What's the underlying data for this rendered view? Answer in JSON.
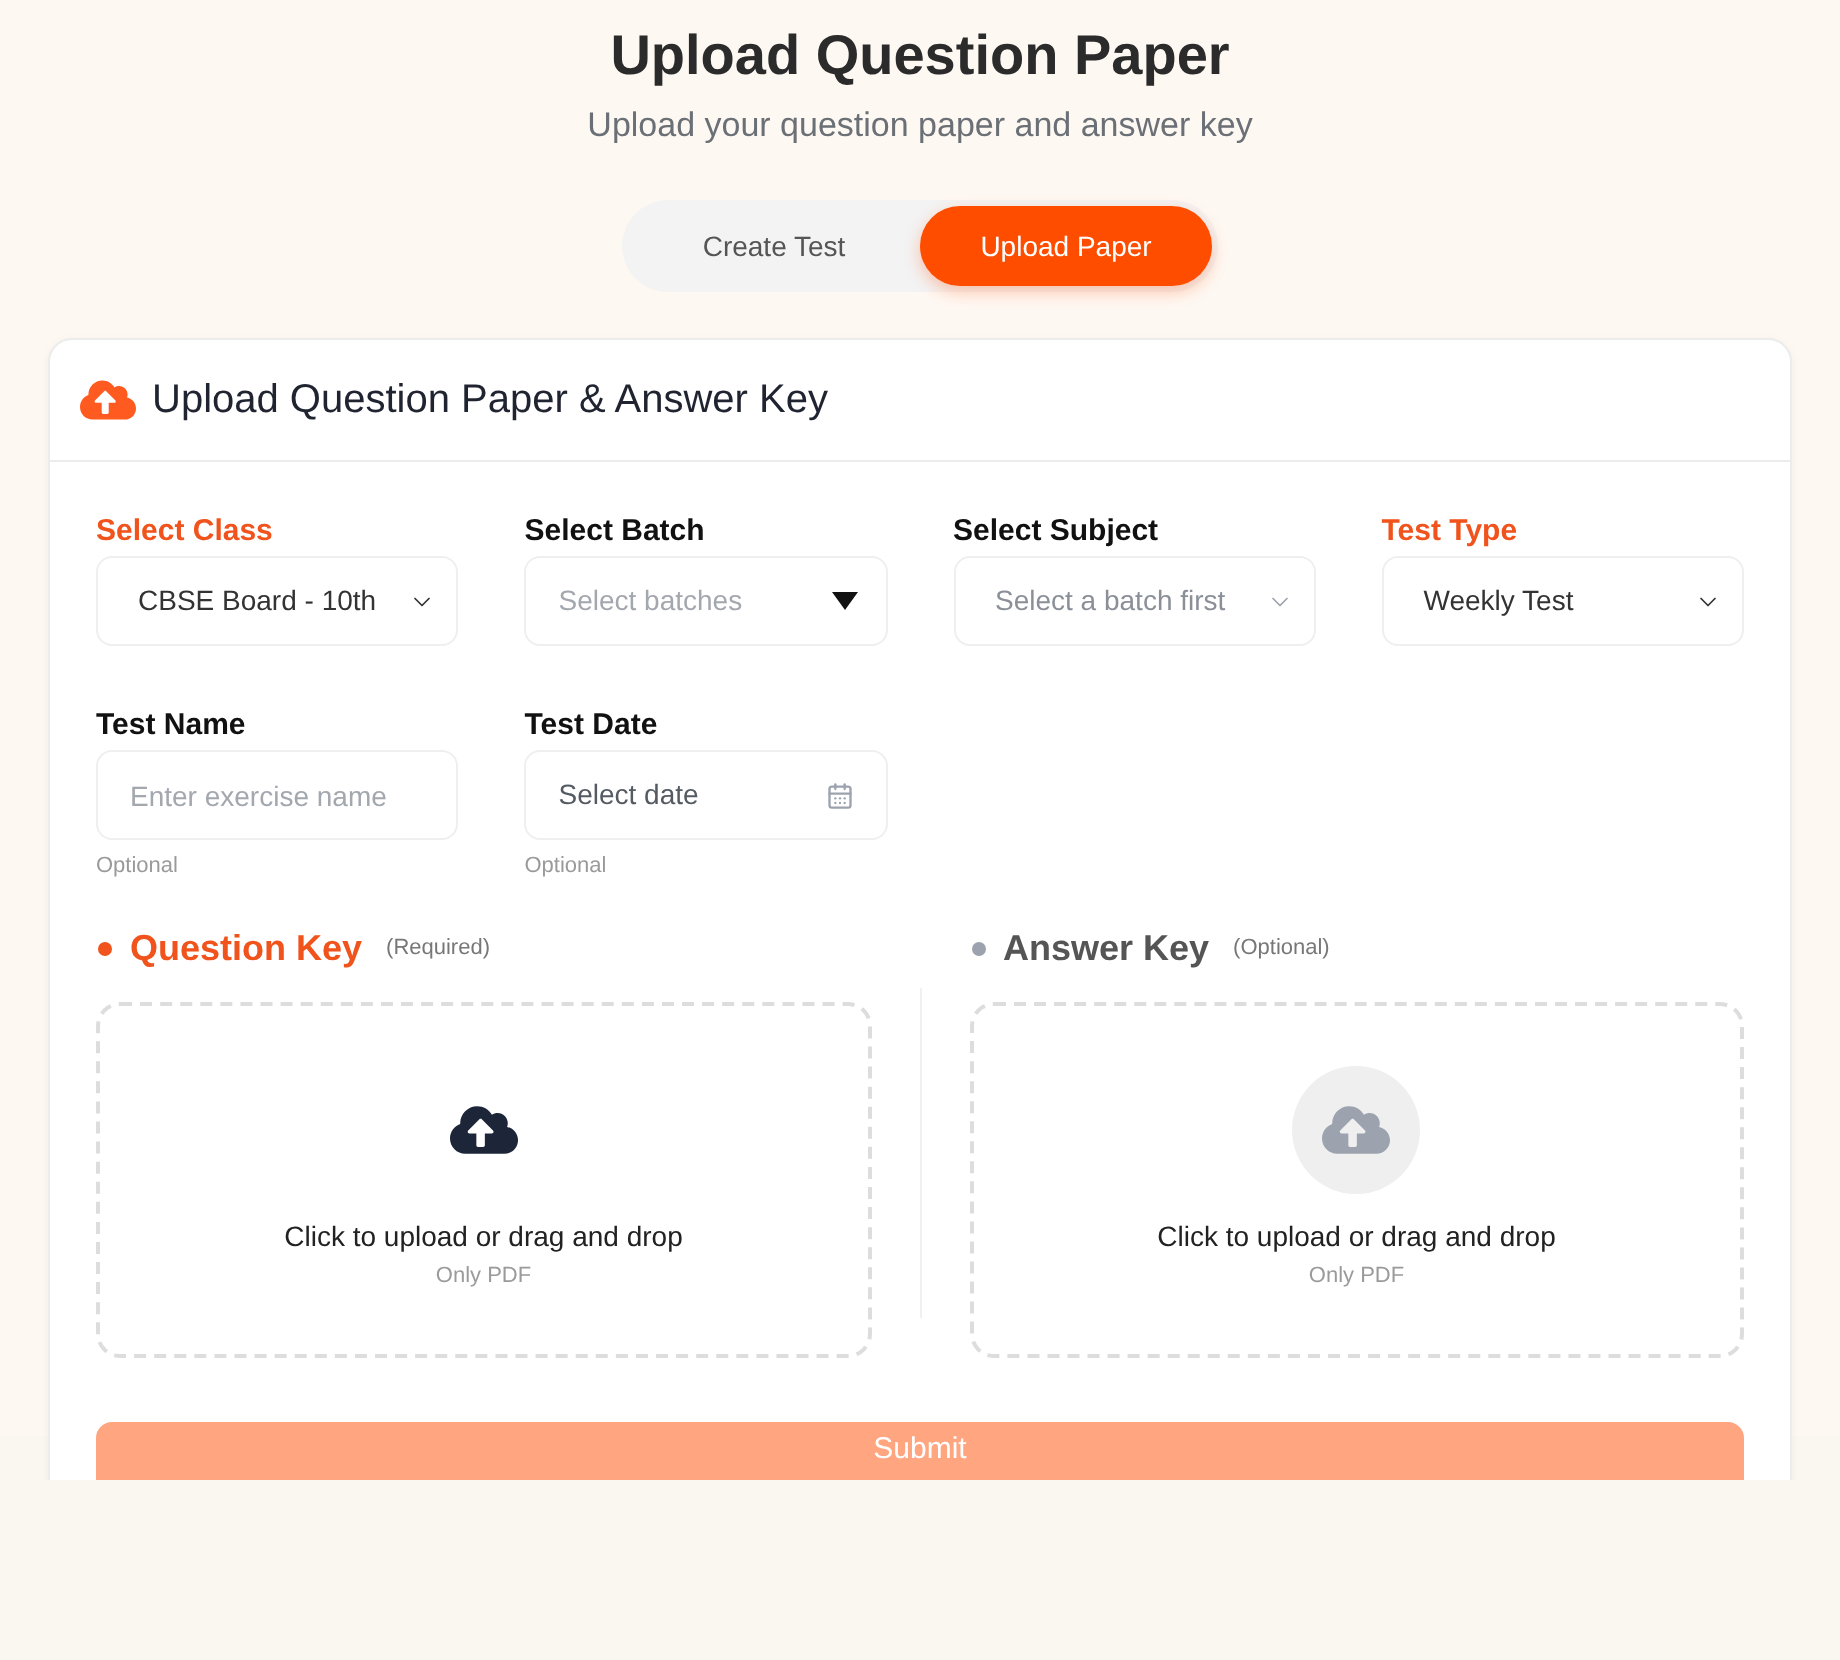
{
  "page": {
    "title": "Upload Question Paper",
    "subtitle": "Upload your question paper and answer key"
  },
  "tabs": [
    {
      "label": "Create Test",
      "selected": false
    },
    {
      "label": "Upload Paper",
      "selected": true
    }
  ],
  "card": {
    "title": "Upload Question Paper & Answer Key"
  },
  "fields": [
    {
      "kind": "select",
      "label": "Select Class",
      "required": true,
      "value": "CBSE Board - 10th"
    },
    {
      "kind": "multiselect",
      "label": "Select Batch",
      "required": false,
      "placeholder": "Select batches"
    },
    {
      "kind": "select",
      "label": "Select Subject",
      "required": false,
      "placeholder": "Select a batch first"
    },
    {
      "kind": "select",
      "label": "Test Type",
      "required": true,
      "value": "Weekly Test"
    },
    {
      "kind": "text",
      "label": "Test Name",
      "required": false,
      "placeholder": "Enter exercise name",
      "hint": "Optional"
    },
    {
      "kind": "date",
      "label": "Test Date",
      "required": false,
      "placeholder": "Select date",
      "hint": "Optional"
    }
  ],
  "uploads": [
    {
      "title": "Question Key",
      "note": "(Required)",
      "required": true,
      "prompt": "Click to upload or drag and drop",
      "hint": "Only PDF"
    },
    {
      "title": "Answer Key",
      "note": "(Optional)",
      "required": false,
      "prompt": "Click to upload or drag and drop",
      "hint": "Only PDF"
    }
  ],
  "submit": {
    "label": "Submit",
    "disabled": true
  }
}
